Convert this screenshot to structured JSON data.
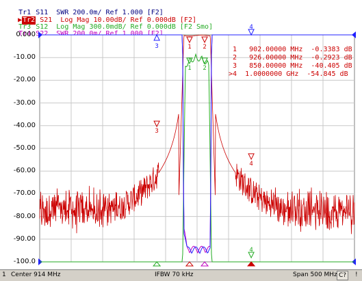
{
  "traces": [
    {
      "id": "Tr1",
      "text": "S11  SWR 200.0m/ Ref 1.000 [F2]",
      "color": "#000080"
    },
    {
      "id": "Tr2",
      "text": "S21  Log Mag 10.00dB/ Ref 0.000dB [F2]",
      "color": "#cc0000"
    },
    {
      "id": "Tr3",
      "text": "S12  Log Mag 300.0mdB/ Ref 0.000dB [F2 Smo]",
      "color": "#22aa22"
    },
    {
      "id": "Tr4",
      "text": "S22  SWR 200.0m/ Ref 1.000 [F2]",
      "color": "#c000c0"
    }
  ],
  "y_axis": {
    "labels": [
      "0.000",
      "-10.00",
      "-20.00",
      "-30.00",
      "-40.00",
      "-50.00",
      "-60.00",
      "-70.00",
      "-80.00",
      "-90.00",
      "-100.0"
    ]
  },
  "markers": {
    "readout": [
      " 1   902.00000 MHz  -0.3383 dB",
      " 2   926.00000 MHz  -0.2923 dB",
      " 3   850.00000 MHz  -40.405 dB",
      ">4  1.0000000 GHz  -54.845 dB"
    ],
    "top_labels": [
      "3",
      "1",
      "2",
      "4"
    ],
    "trace_labels": [
      "1",
      "2",
      "3",
      "4"
    ]
  },
  "status": {
    "channel": "1",
    "center": "Center 914 MHz",
    "ifbw": "IFBW 70 kHz",
    "span": "Span 500 MHz",
    "correction": "C?",
    "alert": "!"
  },
  "chart_data": {
    "type": "line",
    "x_unit": "MHz",
    "xlim": [
      664,
      1164
    ],
    "ylim": [
      -100,
      0
    ],
    "series": [
      {
        "name": "S21",
        "color": "#cc0000"
      },
      {
        "name": "S12",
        "color": "#22aa22"
      },
      {
        "name": "S11",
        "color": "#000080"
      },
      {
        "name": "S22",
        "color": "#c000c0"
      }
    ],
    "markers": [
      {
        "id": "1",
        "x": 902,
        "y": -0.3383
      },
      {
        "id": "2",
        "x": 926,
        "y": -0.2923
      },
      {
        "id": "3",
        "x": 850,
        "y": -40.405
      },
      {
        "id": "4",
        "x": 1000,
        "y": -54.845
      }
    ]
  }
}
